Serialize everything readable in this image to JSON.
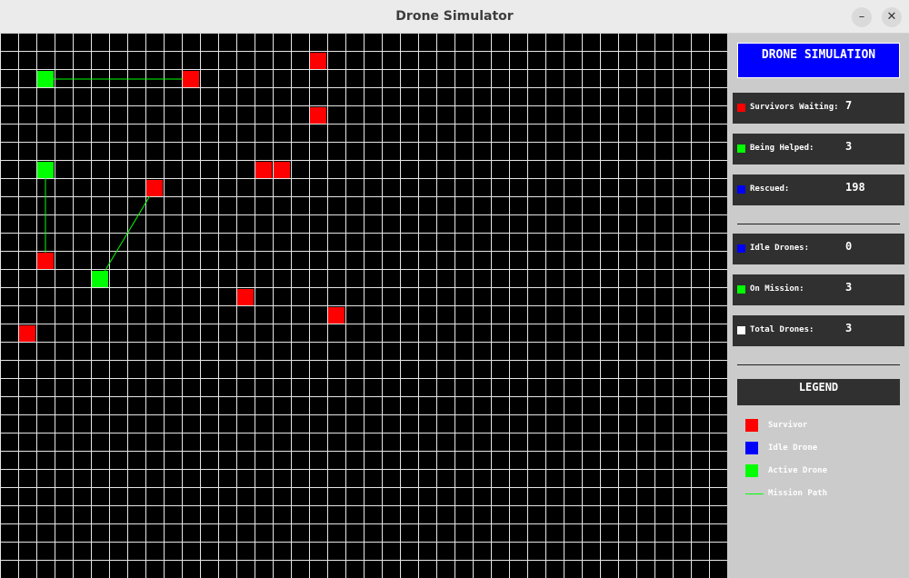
{
  "window": {
    "title": "Drone Simulator",
    "minimize_glyph": "–",
    "close_glyph": "✕"
  },
  "colors": {
    "survivor": "#ff0000",
    "active_drone": "#00ff00",
    "idle_drone": "#0000ff",
    "path": "#00ff00",
    "grid_line": "#e6e6e6",
    "grid_bg": "#000000"
  },
  "grid": {
    "survivors": [
      [
        17,
        1
      ],
      [
        10,
        2
      ],
      [
        17,
        4
      ],
      [
        14,
        7
      ],
      [
        15,
        7
      ],
      [
        8,
        8
      ],
      [
        2,
        12
      ],
      [
        13,
        14
      ],
      [
        18,
        15
      ],
      [
        1,
        16
      ]
    ],
    "drones": [
      [
        2,
        2
      ],
      [
        2,
        7
      ],
      [
        5,
        13
      ]
    ],
    "missions": [
      [
        2,
        2,
        10,
        2
      ],
      [
        2,
        7,
        2,
        12
      ],
      [
        5,
        13,
        8,
        8
      ]
    ]
  },
  "panel": {
    "title": "DRONE SIMULATION",
    "stats": [
      {
        "label": "Survivors Waiting:",
        "value": "7",
        "color": "#ff0000"
      },
      {
        "label": "Being Helped:",
        "value": "3",
        "color": "#00ff00"
      },
      {
        "label": "Rescued:",
        "value": "198",
        "color": "#0000ff"
      },
      {
        "label": "Idle Drones:",
        "value": "0",
        "color": "#0000ff"
      },
      {
        "label": "On Mission:",
        "value": "3",
        "color": "#00ff00"
      },
      {
        "label": "Total Drones:",
        "value": "3",
        "color": "#ffffff"
      }
    ],
    "legend": {
      "title": "LEGEND",
      "items": [
        {
          "label": "Survivor",
          "color": "#ff0000"
        },
        {
          "label": "Idle Drone",
          "color": "#0000ff"
        },
        {
          "label": "Active Drone",
          "color": "#00ff00"
        },
        {
          "label": "Mission Path",
          "color": "#00ff00"
        }
      ]
    }
  }
}
